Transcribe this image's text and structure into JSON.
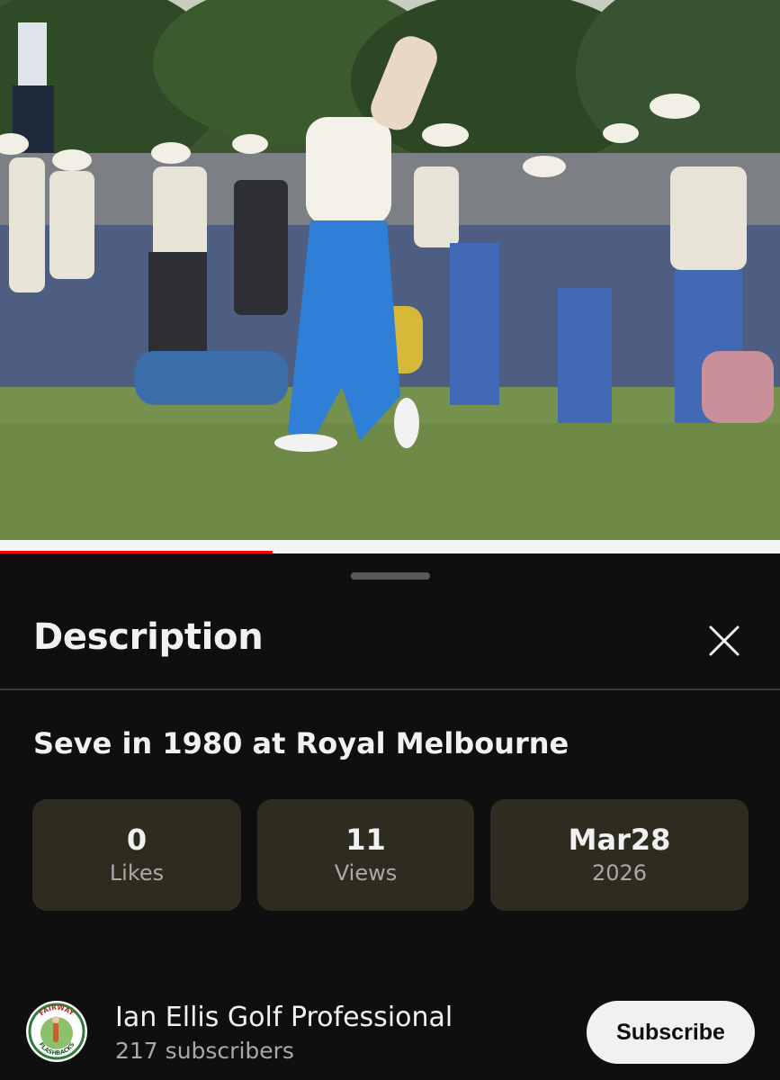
{
  "video": {
    "progress_fraction": 0.35
  },
  "sheet": {
    "title": "Description",
    "close_icon": "close-icon"
  },
  "video_title": "Seve in 1980 at Royal Melbourne",
  "stats": {
    "likes": {
      "value": "0",
      "label": "Likes"
    },
    "views": {
      "value": "11",
      "label": "Views"
    },
    "date": {
      "value": "Mar28",
      "label": "2026"
    }
  },
  "channel": {
    "name": "Ian Ellis Golf Professional",
    "subscribers": "217 subscribers",
    "avatar_text_top": "FAIRWAY",
    "avatar_text_bottom": "FLASHBACKS"
  },
  "subscribe_label": "Subscribe",
  "colors": {
    "background": "#0f0f0f",
    "stat_card": "#2e2b1f",
    "progress": "#ff0000",
    "text_primary": "#f1f1f1",
    "text_secondary": "#a9a9a9"
  }
}
